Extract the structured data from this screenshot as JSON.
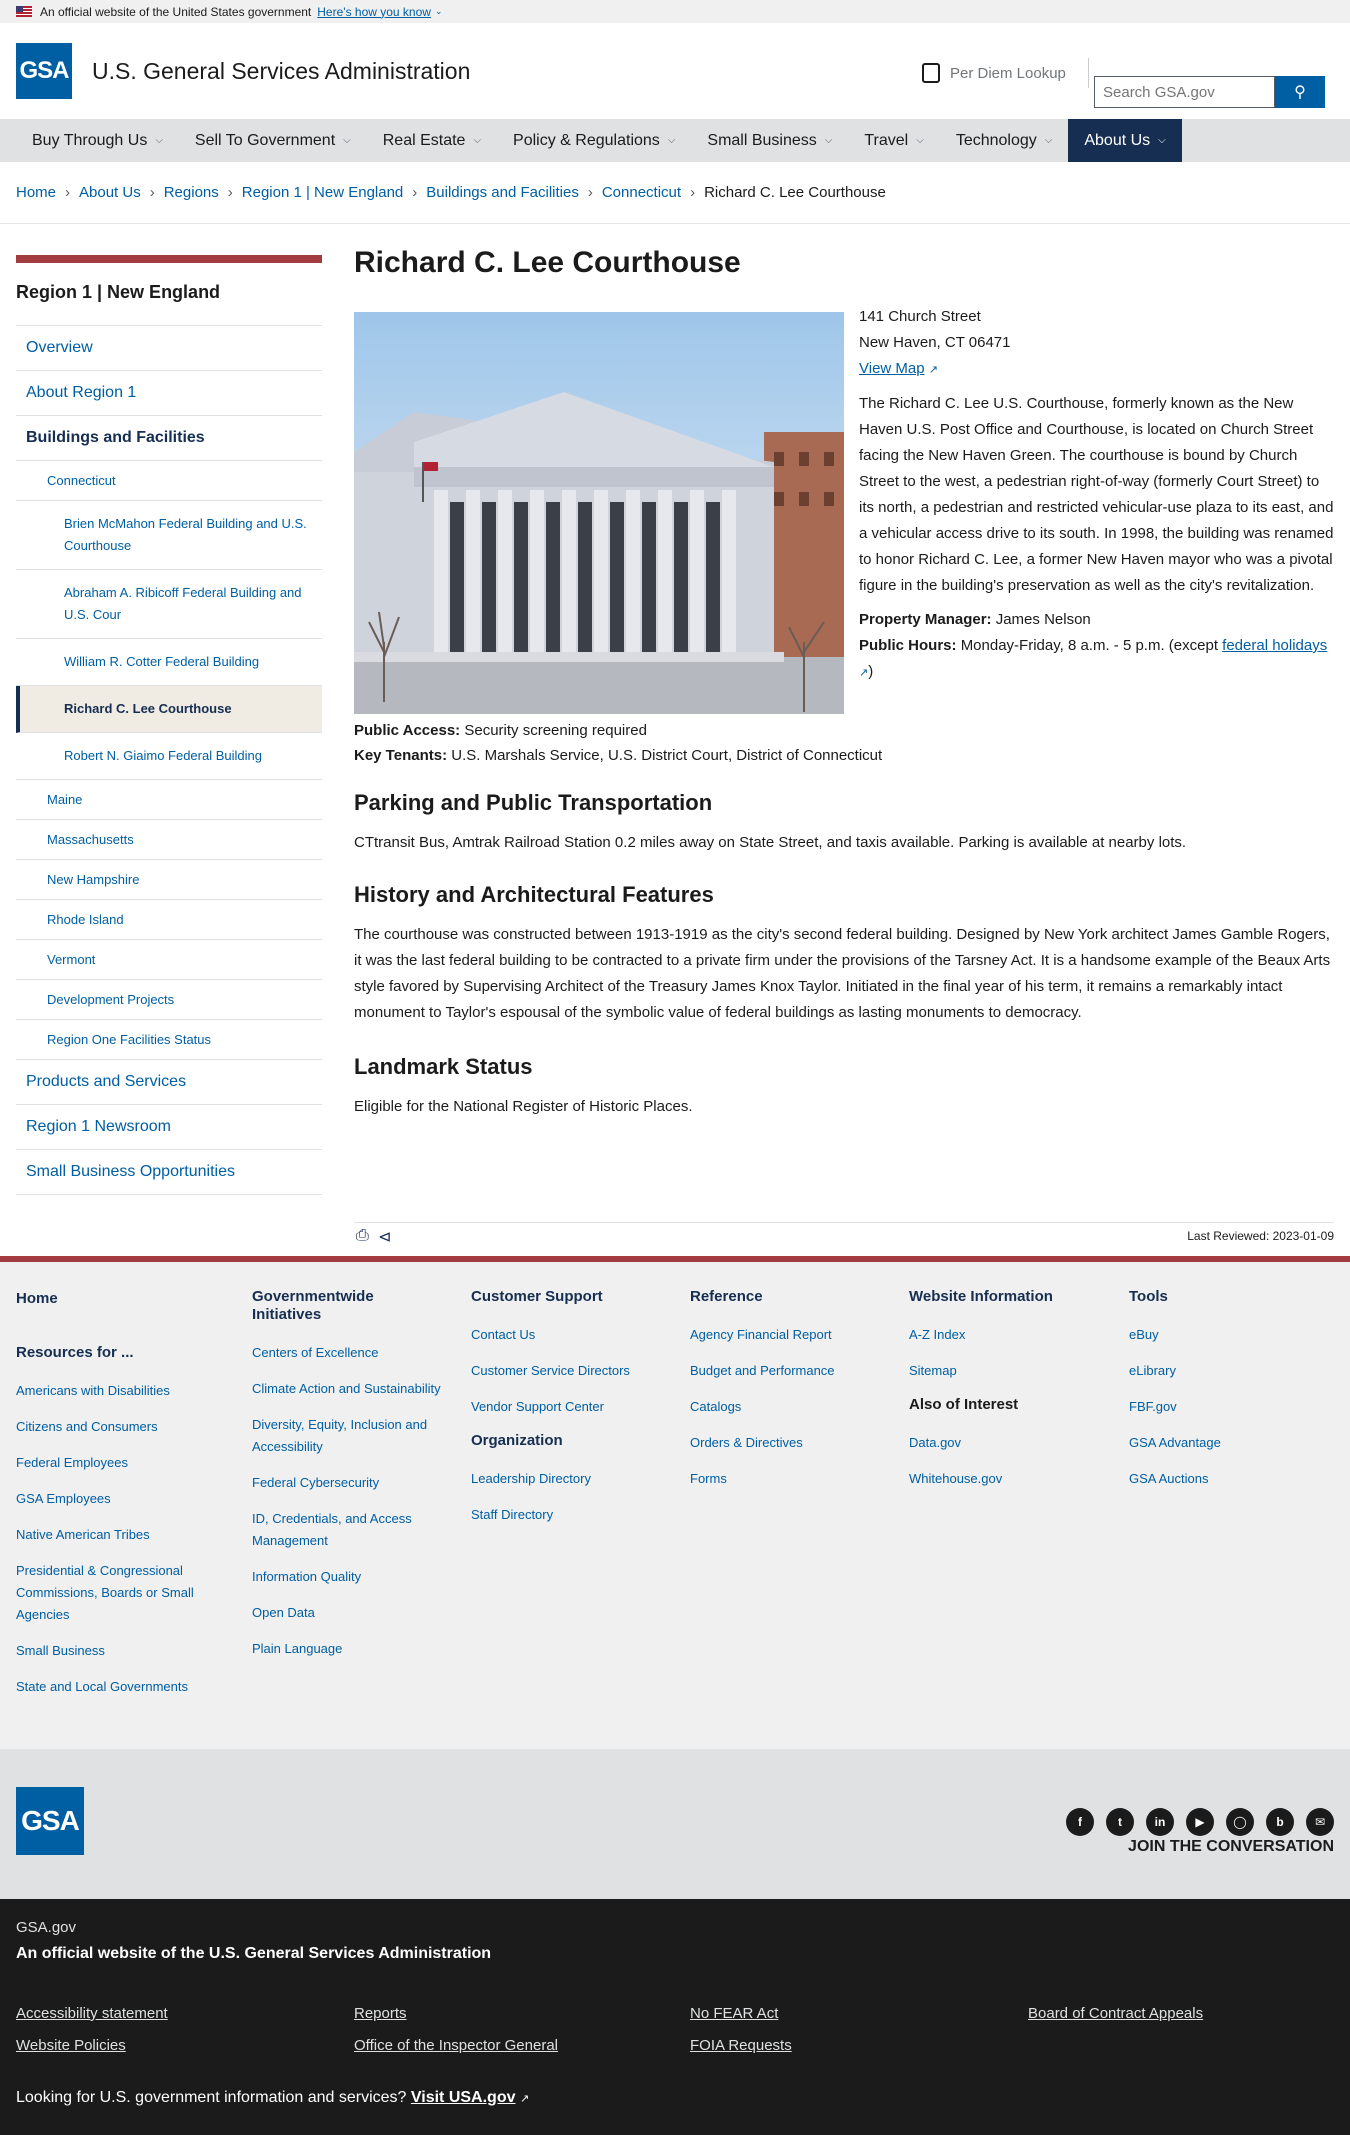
{
  "banner": {
    "text": "An official website of the United States government",
    "how": "Here's how you know"
  },
  "header": {
    "logo": "GSA",
    "title": "U.S. General Services Administration",
    "perdiem": "Per Diem Lookup",
    "search_placeholder": "Search GSA.gov"
  },
  "nav": [
    "Buy Through Us",
    "Sell To Government",
    "Real Estate",
    "Policy & Regulations",
    "Small Business",
    "Travel",
    "Technology",
    "About Us"
  ],
  "breadcrumbs": [
    "Home",
    "About Us",
    "Regions",
    "Region 1 | New England",
    "Buildings and Facilities",
    "Connecticut",
    "Richard C. Lee Courthouse"
  ],
  "sidebar": {
    "title": "Region 1 | New England",
    "items": [
      "Overview",
      "About Region 1",
      "Buildings and Facilities",
      "Connecticut",
      "Brien McMahon Federal Building and U.S. Courthouse",
      "Abraham A. Ribicoff Federal Building and U.S. Cour",
      "William R. Cotter Federal Building",
      "Richard C. Lee Courthouse",
      "Robert N. Giaimo Federal Building",
      "Maine",
      "Massachusetts",
      "New Hampshire",
      "Rhode Island",
      "Vermont",
      "Development Projects",
      "Region One Facilities Status",
      "Products and Services",
      "Region 1 Newsroom",
      "Small Business Opportunities"
    ]
  },
  "page": {
    "title": "Richard C. Lee Courthouse",
    "addr1": "141 Church Street",
    "addr2": "New Haven, CT 06471",
    "map": "View Map",
    "desc": "The Richard C. Lee U.S. Courthouse, formerly known as the New Haven U.S. Post Office and Courthouse, is located on Church Street facing the New Haven Green. The courthouse is bound by Church Street to the west, a pedestrian right-of-way (formerly Court Street) to its north, a pedestrian and restricted vehicular-use plaza to its east, and a vehicular access drive to its south. In 1998, the building was renamed to honor Richard C. Lee, a former New Haven mayor who was a pivotal figure in the building's preservation as well as the city's revitalization.",
    "pm_label": "Property Manager:",
    "pm": "James Nelson",
    "hours_label": "Public Hours:",
    "hours": "Monday-Friday, 8 a.m. - 5 p.m. (except",
    "holidays": "federal holidays",
    "access_label": "Public Access:",
    "access": "Security screening required",
    "tenants_label": "Key Tenants:",
    "tenants": "U.S. Marshals Service, U.S. District Court, District of Connecticut",
    "h_parking": "Parking and Public Transportation",
    "parking": "CTtransit Bus, Amtrak Railroad Station 0.2 miles away on State Street, and taxis available. Parking is available at nearby lots.",
    "h_history": "History and Architectural Features",
    "history": "The courthouse was constructed between 1913-1919 as the city's second federal building. Designed by New York architect James Gamble Rogers, it was the last federal building to be contracted to a private firm under the provisions of the Tarsney Act. It is a handsome example of the Beaux Arts style favored by Supervising Architect of the Treasury James Knox Taylor. Initiated in the final year of his term, it remains a remarkably intact monument to Taylor's espousal of the symbolic value of federal buildings as lasting monuments to democracy.",
    "h_landmark": "Landmark Status",
    "landmark": "Eligible for the National Register of Historic Places.",
    "last_reviewed": "Last Reviewed: 2023-01-09"
  },
  "footer": {
    "c1": {
      "home": "Home",
      "res": "Resources for ...",
      "links": [
        "Americans with Disabilities",
        "Citizens and Consumers",
        "Federal Employees",
        "GSA Employees",
        "Native American Tribes",
        "Presidential & Congressional Commissions, Boards or Small Agencies",
        "Small Business",
        "State and Local Governments"
      ]
    },
    "c2": {
      "h": "Governmentwide Initiatives",
      "links": [
        "Centers of Excellence",
        "Climate Action and Sustainability",
        "Diversity, Equity, Inclusion and Accessibility",
        "Federal Cybersecurity",
        "ID, Credentials, and Access Management",
        "Information Quality",
        "Open Data",
        "Plain Language"
      ]
    },
    "c3": {
      "h": "Customer Support",
      "links": [
        "Contact Us",
        "Customer Service Directors",
        "Vendor Support Center"
      ],
      "h2": "Organization",
      "links2": [
        "Leadership Directory",
        "Staff Directory"
      ]
    },
    "c4": {
      "h": "Reference",
      "links": [
        "Agency Financial Report",
        "Budget and Performance",
        "Catalogs",
        "Orders & Directives",
        "Forms"
      ]
    },
    "c5": {
      "h": "Website Information",
      "links": [
        "A-Z Index",
        "Sitemap"
      ],
      "h2": "Also of Interest",
      "links2": [
        "Data.gov",
        "Whitehouse.gov"
      ]
    },
    "c6": {
      "h": "Tools",
      "links": [
        "eBuy",
        "eLibrary",
        "FBF.gov",
        "GSA Advantage",
        "GSA Auctions"
      ]
    },
    "join": "JOIN THE CONVERSATION",
    "gsagov": "GSA.gov",
    "official": "An official website of the U.S. General Services Administration",
    "bottom": [
      "Accessibility statement",
      "Reports",
      "No FEAR Act",
      "Board of Contract Appeals",
      "Website Policies",
      "Office of the Inspector General",
      "FOIA Requests"
    ],
    "usa_q": "Looking for U.S. government information and services?",
    "usa_link": "Visit USA.gov"
  }
}
